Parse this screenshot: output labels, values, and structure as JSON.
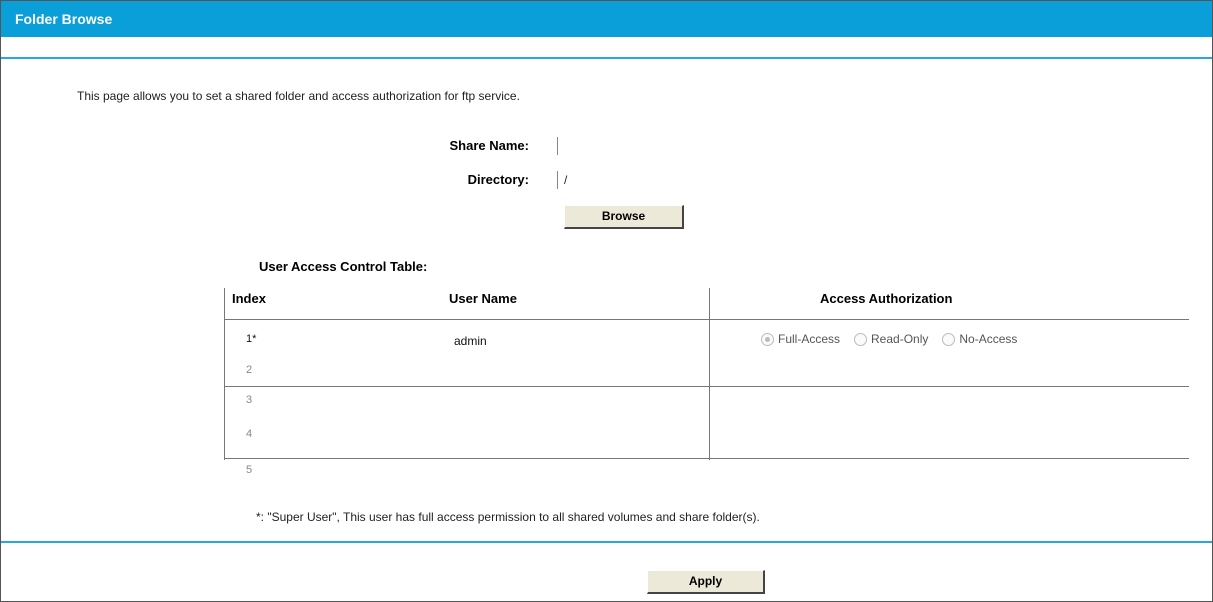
{
  "header": {
    "title": "Folder Browse"
  },
  "intro_text": "This page allows you to set a shared folder and access authorization for ftp service.",
  "form": {
    "share_name_label": "Share Name:",
    "share_name_value": "",
    "directory_label": "Directory:",
    "directory_value": "/",
    "browse_label": "Browse"
  },
  "table": {
    "title": "User Access Control Table:",
    "columns": [
      "Index",
      "User Name",
      "Access Authorization"
    ],
    "rows": [
      {
        "index": "1*",
        "user_name": "admin"
      },
      {
        "index": "2",
        "user_name": ""
      },
      {
        "index": "3",
        "user_name": ""
      },
      {
        "index": "4",
        "user_name": ""
      },
      {
        "index": "5",
        "user_name": ""
      }
    ],
    "access_options": [
      "Full-Access",
      "Read-Only",
      "No-Access"
    ],
    "selected_access": "Full-Access"
  },
  "note": "*: \"Super User\", This user has full access permission to all shared volumes and share folder(s).",
  "footer": {
    "apply_label": "Apply"
  },
  "colors": {
    "accent": "#0a9fd8"
  }
}
